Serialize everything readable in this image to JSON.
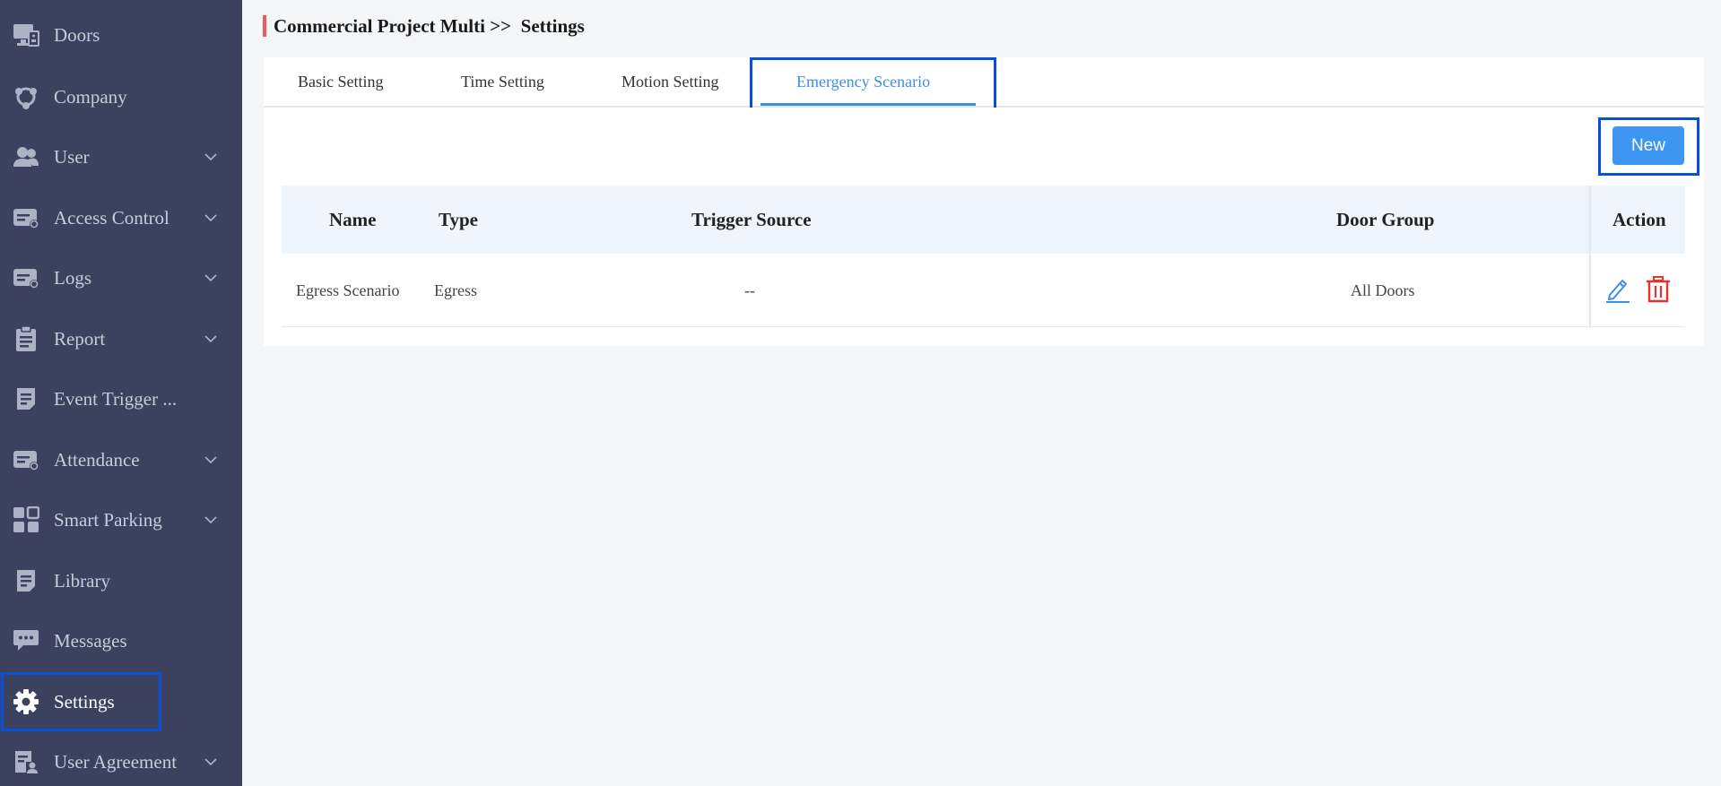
{
  "sidebar": {
    "items": [
      {
        "label": "Doors",
        "icon": "monitor-icon",
        "has_chevron": false
      },
      {
        "label": "Company",
        "icon": "company-icon",
        "has_chevron": false
      },
      {
        "label": "User",
        "icon": "users-icon",
        "has_chevron": true
      },
      {
        "label": "Access Control",
        "icon": "card-icon",
        "has_chevron": true
      },
      {
        "label": "Logs",
        "icon": "card-icon",
        "has_chevron": true
      },
      {
        "label": "Report",
        "icon": "clipboard-icon",
        "has_chevron": true
      },
      {
        "label": "Event Trigger ...",
        "icon": "document-icon",
        "has_chevron": false
      },
      {
        "label": "Attendance",
        "icon": "card-icon",
        "has_chevron": true
      },
      {
        "label": "Smart Parking",
        "icon": "grid-icon",
        "has_chevron": true
      },
      {
        "label": "Library",
        "icon": "document-icon",
        "has_chevron": false
      },
      {
        "label": "Messages",
        "icon": "chat-icon",
        "has_chevron": false
      },
      {
        "label": "Settings",
        "icon": "gear-icon",
        "has_chevron": false,
        "active": true
      },
      {
        "label": "User Agreement",
        "icon": "user-doc-icon",
        "has_chevron": true
      }
    ]
  },
  "breadcrumb": {
    "project": "Commercial Project Multi",
    "separator": " >>  ",
    "page": "Settings"
  },
  "tabs": [
    {
      "label": "Basic Setting",
      "active": false
    },
    {
      "label": "Time Setting",
      "active": false
    },
    {
      "label": "Motion Setting",
      "active": false
    },
    {
      "label": "Emergency Scenario",
      "active": true
    }
  ],
  "toolbar": {
    "new_label": "New"
  },
  "table": {
    "columns": [
      "Name",
      "Type",
      "Trigger Source",
      "Door Group",
      "Action"
    ],
    "rows": [
      {
        "name": "Egress Scenario",
        "type": "Egress",
        "trigger_source": "--",
        "door_group": "All Doors",
        "actions": [
          "edit-icon",
          "delete-icon"
        ]
      }
    ]
  },
  "colors": {
    "sidebar_bg": "#3c4160",
    "accent": "#3d8fe6",
    "new_button": "#3d97f0",
    "breadcrumb_bar": "#f0575f",
    "delete": "#e8322f",
    "highlight_box": "#0b4fd9"
  }
}
